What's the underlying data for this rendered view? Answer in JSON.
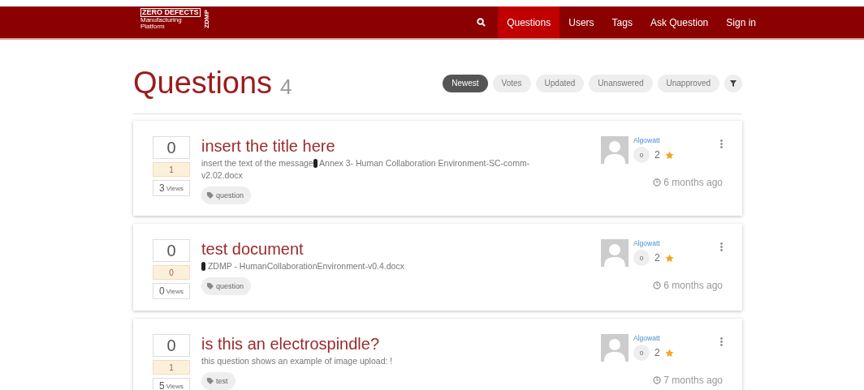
{
  "logo": {
    "title": "ZERO DEFECTS",
    "subtitle": "Manufacturing Platform",
    "side": "ZDMP"
  },
  "nav": [
    {
      "label": "Questions",
      "selected": true
    },
    {
      "label": "Users",
      "selected": false
    },
    {
      "label": "Tags",
      "selected": false
    },
    {
      "label": "Ask Question",
      "selected": false
    },
    {
      "label": "Sign in",
      "selected": false
    }
  ],
  "heading": {
    "title": "Questions",
    "count": "4"
  },
  "sorts": [
    {
      "label": "Newest",
      "selected": true
    },
    {
      "label": "Votes",
      "selected": false
    },
    {
      "label": "Updated",
      "selected": false
    },
    {
      "label": "Unanswered",
      "selected": false
    },
    {
      "label": "Unapproved",
      "selected": false
    }
  ],
  "questions": [
    {
      "votes": "0",
      "answers": "1",
      "views": "3",
      "views_label": "Views",
      "title": "insert the title here",
      "excerpt_before": "insert the text of the message",
      "attachment": true,
      "excerpt_after": " Annex 3- Human Collaboration Environment-SC-comm-v2.02.docx",
      "tags": [
        "question"
      ],
      "author": "Algowatt",
      "badge": "0",
      "stars_count": "2",
      "time": "6 months ago"
    },
    {
      "votes": "0",
      "answers": "0",
      "views": "0",
      "views_label": "Views",
      "title": "test document",
      "attachment": true,
      "excerpt_after": " ZDMP - HumanCollaborationEnvironment-v0.4.docx",
      "tags": [
        "question"
      ],
      "author": "Algowatt",
      "badge": "0",
      "stars_count": "2",
      "time": "6 months ago"
    },
    {
      "votes": "0",
      "answers": "1",
      "views": "5",
      "views_label": "Views",
      "title": "is this an electrospindle?",
      "excerpt_before": "this question shows an example of image upload: !",
      "attachment": false,
      "tags": [
        "test"
      ],
      "author": "Algowatt",
      "badge": "0",
      "stars_count": "2",
      "time": "7 months ago"
    }
  ]
}
